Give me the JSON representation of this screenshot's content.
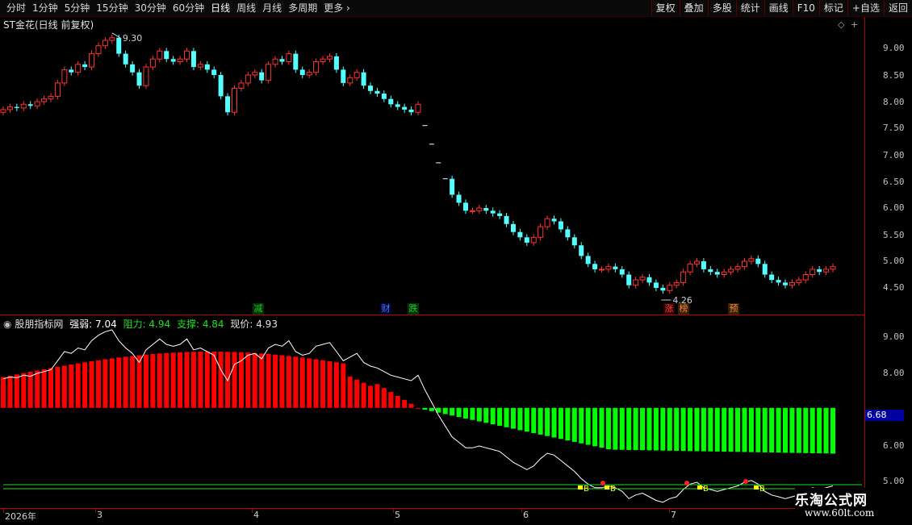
{
  "toolbar": {
    "timeframes": [
      "分时",
      "1分钟",
      "5分钟",
      "15分钟",
      "30分钟",
      "60分钟",
      "日线",
      "周线",
      "月线",
      "多周期",
      "更多"
    ],
    "active_timeframe": "日线",
    "buttons": [
      "复权",
      "叠加",
      "多股",
      "统计",
      "画线",
      "F10",
      "标记",
      "+自选",
      "返回"
    ]
  },
  "main_panel": {
    "title": "ST金花(日线 前复权)",
    "high_label": "9.30",
    "low_label": "4.26",
    "y_ticks": [
      "9.00",
      "8.50",
      "8.00",
      "7.50",
      "7.00",
      "6.50",
      "6.00",
      "5.50",
      "5.00",
      "4.50"
    ],
    "events": [
      {
        "text": "减",
        "color": "#20c040",
        "bg": "#003300"
      },
      {
        "text": "财",
        "color": "#4080ff",
        "bg": "#000033"
      },
      {
        "text": "跌",
        "color": "#20c040",
        "bg": "#003300"
      },
      {
        "text": "涨",
        "color": "#ff4040",
        "bg": "#330000"
      },
      {
        "text": "榜",
        "color": "#ff8040",
        "bg": "#332200"
      },
      {
        "text": "预",
        "color": "#ff8040",
        "bg": "#332200"
      }
    ]
  },
  "indicator_panel": {
    "name": "股朋指标网",
    "strength_label": "强弱: 7.04",
    "resist_label": "阻力: 4.94",
    "support_label": "支撑: 4.84",
    "price_label": "现价: 4.93",
    "y_ticks": [
      "9.00",
      "8.00",
      "6.00",
      "5.00"
    ],
    "current_value": "6.68",
    "b_marks": [
      "B",
      "B",
      "B",
      "B"
    ]
  },
  "x_axis": {
    "labels": [
      "2026年",
      "3",
      "4",
      "5",
      "6",
      "7"
    ]
  },
  "watermark": {
    "line1": "乐淘公式网",
    "line2": "www.60lt.com"
  },
  "colors": {
    "up": "#ff3232",
    "down": "#54ffff",
    "bar_red": "#ff0000",
    "bar_green": "#00ff00",
    "line": "#ffffff"
  }
}
